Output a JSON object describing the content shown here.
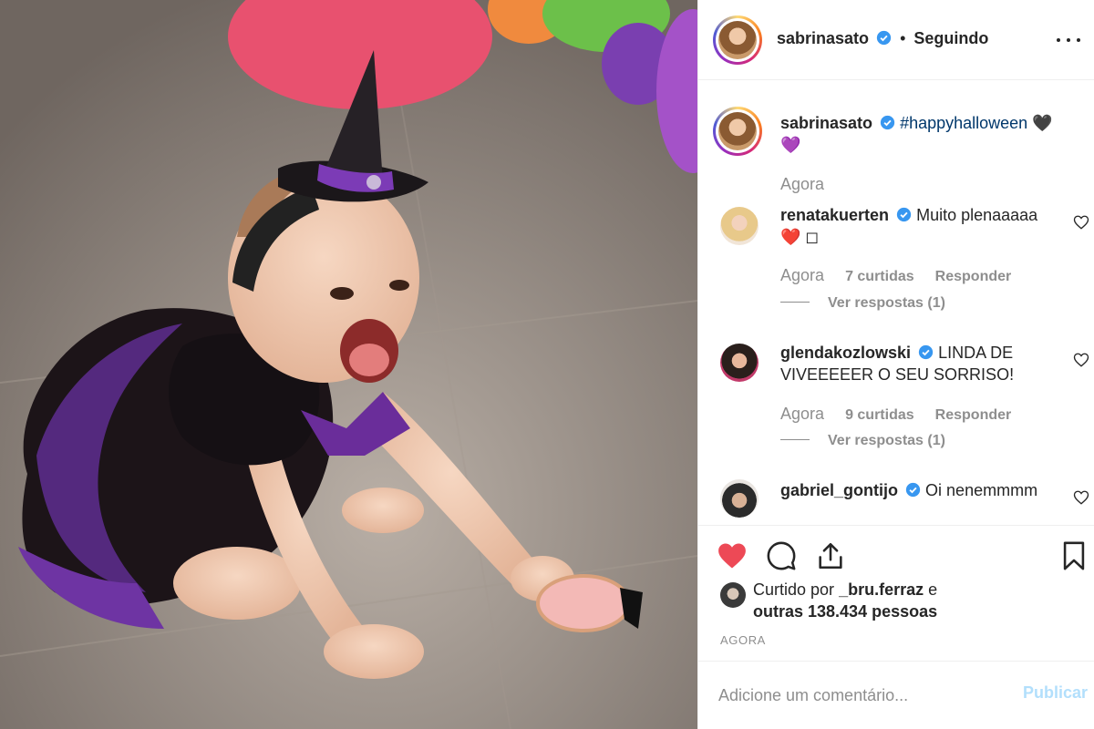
{
  "post": {
    "author": "sabrinasato",
    "follow_separator": "•",
    "follow_status": "Seguindo"
  },
  "caption": {
    "username": "sabrinasato",
    "hashtag": "#happyhalloween",
    "emoji": "🖤",
    "emoji_line2": "💜",
    "time": "Agora"
  },
  "comments": [
    {
      "username": "renatakuerten",
      "text": "Muito plenaaaaa",
      "text_line2": "❤️ ◻",
      "time": "Agora",
      "likes": "7 curtidas",
      "reply_label": "Responder",
      "view_replies": "Ver respostas (1)"
    },
    {
      "username": "glendakozlowski",
      "text": "LINDA DE VIVEEEEER O SEU SORRISO!",
      "time": "Agora",
      "likes": "9 curtidas",
      "reply_label": "Responder",
      "view_replies": "Ver respostas (1)"
    },
    {
      "username": "gabriel_gontijo",
      "text": "Oi nenemmmm"
    }
  ],
  "likes": {
    "prefix": "Curtido por",
    "user": "_bru.ferraz",
    "conj": "e",
    "others": "outras 138.434 pessoas"
  },
  "timestamp": "AGORA",
  "add_comment": {
    "placeholder": "Adicione um comentário...",
    "publish_label": "Publicar"
  },
  "icons": {
    "like": "heart-filled-icon",
    "comment": "comment-bubble-icon",
    "share": "share-arrow-icon",
    "save": "bookmark-icon",
    "verified": "verified-badge-icon"
  },
  "colors": {
    "like_red": "#ed4956",
    "verified_blue": "#3897f0",
    "hashtag_blue": "#00376b",
    "muted_gray": "#8e8e8e",
    "publish_disabled": "#b2dffc"
  }
}
